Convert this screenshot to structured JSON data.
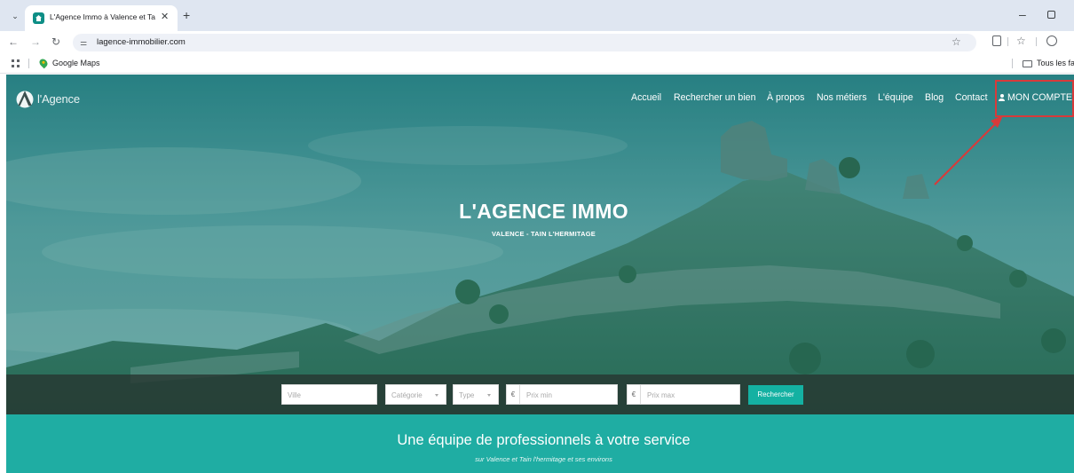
{
  "browser": {
    "tab_title": "L'Agence Immo à Valence et Ta",
    "url": "lagence-immobilier.com",
    "bookmarks": [
      {
        "label": "Google Maps"
      }
    ],
    "bookmarks_folder_label": "Tous les favo"
  },
  "site": {
    "logo_text": "l'Agence",
    "nav": [
      {
        "label": "Accueil"
      },
      {
        "label": "Rechercher un bien"
      },
      {
        "label": "À propos"
      },
      {
        "label": "Nos métiers"
      },
      {
        "label": "L'équipe"
      },
      {
        "label": "Blog"
      },
      {
        "label": "Contact"
      }
    ],
    "account_label": "MON COMPTE",
    "hero": {
      "title": "L'AGENCE IMMO",
      "subtitle": "VALENCE - TAIN L'HERMITAGE"
    },
    "search": {
      "city_placeholder": "Ville",
      "category_label": "Catégorie",
      "type_label": "Type",
      "currency_symbol": "€",
      "price_min_placeholder": "Prix min",
      "price_max_placeholder": "Prix max",
      "submit_label": "Rechercher"
    },
    "band": {
      "title": "Une équipe de professionnels à votre service",
      "subtitle": "sur Valence et Tain l'hermitage et ses environs"
    }
  },
  "colors": {
    "accent": "#1fada3",
    "button": "#14b1a2",
    "annotation": "#d83a3a"
  },
  "icons": {
    "tab_favicon": "house-icon",
    "close": "close-icon",
    "account": "user-icon",
    "search_tune": "tune-icon",
    "bookmark": "star-icon"
  }
}
